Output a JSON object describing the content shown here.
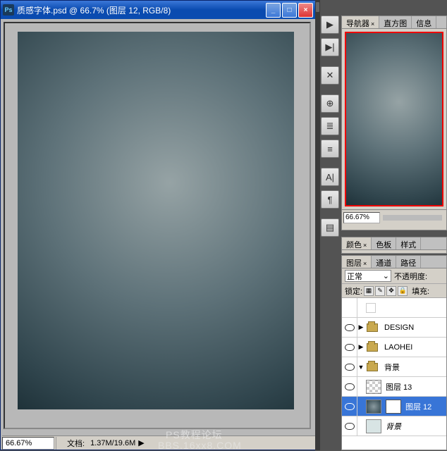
{
  "window": {
    "title": "质感字体.psd @ 66.7% (图层 12, RGB/8)",
    "icon_label": "Ps"
  },
  "status": {
    "zoom": "66.67%",
    "doc_label": "文档:",
    "doc_size": "1.37M/19.6M"
  },
  "tools": {
    "items": [
      "▶",
      "▶|",
      "✕",
      "⊕",
      "≣",
      "≡",
      "A|",
      "¶",
      "▤"
    ]
  },
  "navigator": {
    "tabs": [
      "导航器",
      "直方图",
      "信息"
    ],
    "active_tab": 0,
    "zoom": "66.67%"
  },
  "color_panel": {
    "tabs": [
      "颜色",
      "色板",
      "样式"
    ],
    "active_tab": 0
  },
  "layers_panel": {
    "tabs": [
      "图层",
      "通道",
      "路径"
    ],
    "active_tab": 0,
    "blend_mode": "正常",
    "opacity_label": "不透明度:",
    "lock_label": "锁定:",
    "fill_label": "填充:",
    "layers": [
      {
        "type": "spacer",
        "name": "",
        "visible": false
      },
      {
        "type": "group",
        "name": "DESIGN",
        "visible": true,
        "open": false
      },
      {
        "type": "group",
        "name": "LAOHEI",
        "visible": true,
        "open": false
      },
      {
        "type": "group",
        "name": "背景",
        "visible": true,
        "open": true
      },
      {
        "type": "layer",
        "name": "图层 13",
        "visible": true,
        "indent": 1,
        "thumb": "checker"
      },
      {
        "type": "layer",
        "name": "图层 12",
        "visible": true,
        "indent": 1,
        "thumb": "gradient",
        "mask": true,
        "selected": true
      },
      {
        "type": "layer",
        "name": "背景",
        "visible": true,
        "indent": 1,
        "thumb": "plain",
        "italic": true
      }
    ]
  },
  "watermark": {
    "line1": "PS教程论坛",
    "line2": "BBS.16xx8.COM"
  }
}
